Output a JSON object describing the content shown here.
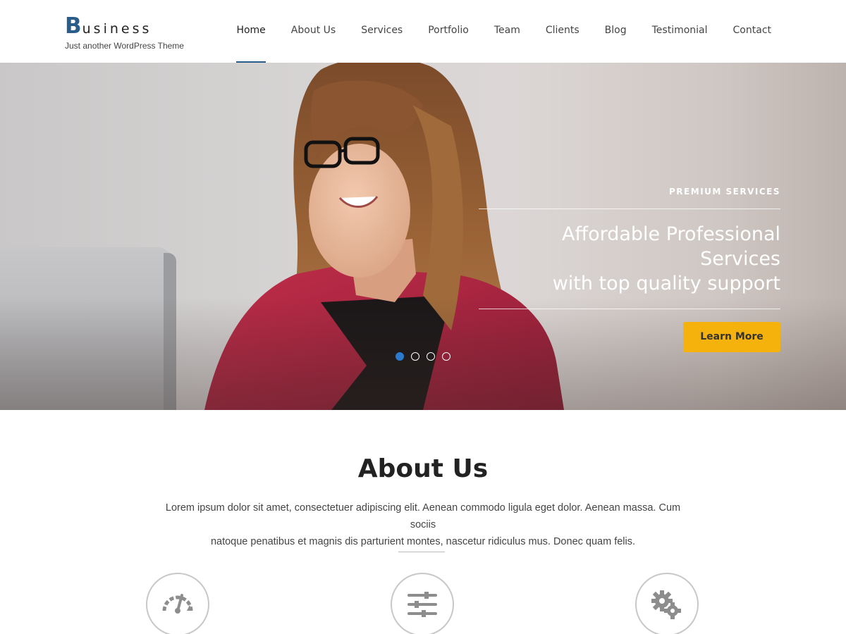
{
  "header": {
    "logo": {
      "initial": "B",
      "rest": "usiness",
      "tagline": "Just another WordPress Theme"
    },
    "nav": [
      {
        "label": "Home",
        "active": true
      },
      {
        "label": "About Us"
      },
      {
        "label": "Services"
      },
      {
        "label": "Portfolio"
      },
      {
        "label": "Team"
      },
      {
        "label": "Clients"
      },
      {
        "label": "Blog"
      },
      {
        "label": "Testimonial"
      },
      {
        "label": "Contact"
      }
    ]
  },
  "hero": {
    "eyebrow": "PREMIUM SERVICES",
    "headline_line1": "Affordable Professional Services",
    "headline_line2": "with top quality support",
    "cta_label": "Learn More",
    "slides_count": 4,
    "active_slide": 1
  },
  "about": {
    "title": "About Us",
    "text_line1": "Lorem ipsum dolor sit amet, consectetuer adipiscing elit. Aenean commodo ligula eget dolor. Aenean massa. Cum sociis",
    "text_line2": "natoque penatibus et magnis dis parturient montes, nascetur ridiculus mus. Donec quam felis.",
    "features": [
      {
        "icon": "speedometer-icon"
      },
      {
        "icon": "sliders-icon"
      },
      {
        "icon": "gears-icon"
      }
    ]
  },
  "colors": {
    "brand": "#2a5d8a",
    "cta": "#f6b20c",
    "active_dot": "#2a7bd0"
  }
}
